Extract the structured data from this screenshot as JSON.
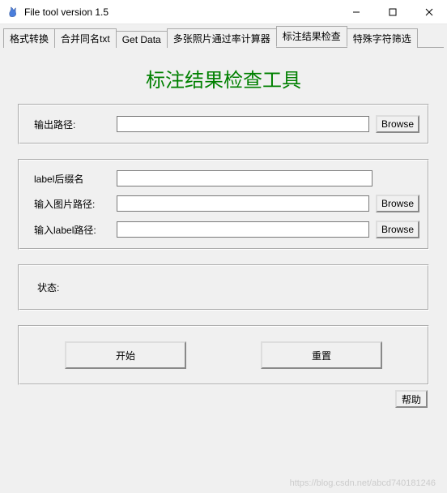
{
  "window": {
    "title": "File tool version 1.5"
  },
  "tabs": [
    {
      "label": "格式转换"
    },
    {
      "label": "合并同名txt"
    },
    {
      "label": "Get Data"
    },
    {
      "label": "多张照片通过率计算器"
    },
    {
      "label": "标注结果检查"
    },
    {
      "label": "特殊字符筛选"
    }
  ],
  "active_tab_index": 4,
  "page_title": "标注结果检查工具",
  "group_output": {
    "output_path_label": "输出路径:",
    "output_path_value": "",
    "browse_label": "Browse"
  },
  "group_input": {
    "label_suffix_label": "label后缀名",
    "label_suffix_value": "",
    "image_path_label": "输入图片路径:",
    "image_path_value": "",
    "label_path_label": "输入label路径:",
    "label_path_value": "",
    "browse_label": "Browse"
  },
  "status": {
    "label": "状态:",
    "value": ""
  },
  "actions": {
    "start_label": "开始",
    "reset_label": "重置"
  },
  "help_label": "帮助",
  "watermark": "https://blog.csdn.net/abcd740181246"
}
